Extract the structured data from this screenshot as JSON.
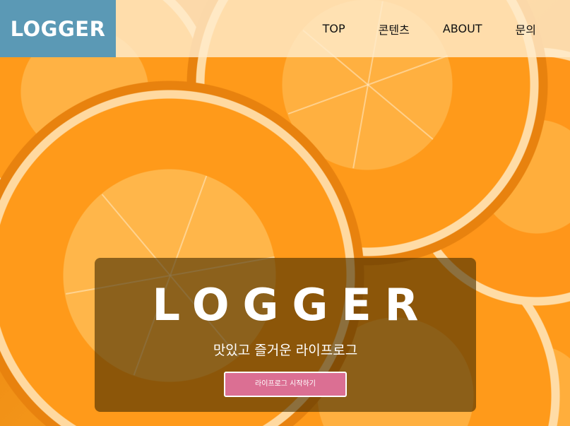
{
  "header": {
    "logo": "LOGGER",
    "nav": [
      {
        "label": "TOP"
      },
      {
        "label": "콘텐츠"
      },
      {
        "label": "ABOUT"
      },
      {
        "label": "문의"
      }
    ]
  },
  "hero": {
    "title": "LOGGER",
    "subtitle": "맛있고 즐거운 라이프로그",
    "cta_label": "라이프로그 시작하기"
  },
  "colors": {
    "logo_bg": "#5b99b5",
    "cta_bg": "#db6f93",
    "header_bg": "#ffeccc"
  }
}
